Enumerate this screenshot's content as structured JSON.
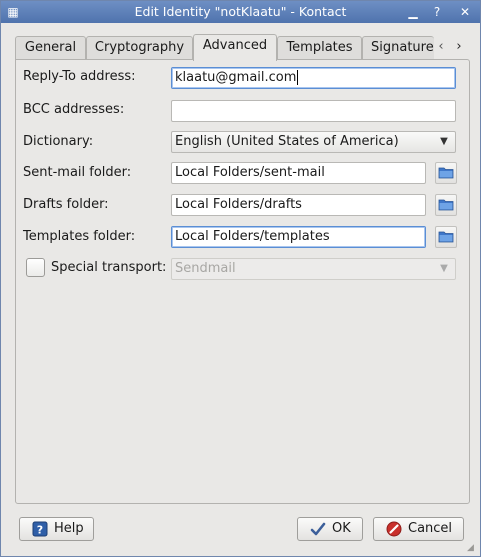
{
  "window": {
    "title": "Edit Identity \"notKlaatu\" - Kontact"
  },
  "tabs": [
    {
      "label": "General"
    },
    {
      "label": "Cryptography"
    },
    {
      "label": "Advanced"
    },
    {
      "label": "Templates"
    },
    {
      "label": "Signature"
    }
  ],
  "form": {
    "reply_to": {
      "label": "Reply-To address:",
      "value": "klaatu@gmail.com"
    },
    "bcc": {
      "label": "BCC addresses:",
      "value": ""
    },
    "dictionary": {
      "label": "Dictionary:",
      "value": "English (United States of America)"
    },
    "sent_mail": {
      "label": "Sent-mail folder:",
      "value": "Local Folders/sent-mail"
    },
    "drafts": {
      "label": "Drafts folder:",
      "value": "Local Folders/drafts"
    },
    "templates": {
      "label": "Templates folder:",
      "value": "Local Folders/templates"
    },
    "transport": {
      "label": "Special transport:",
      "value": "Sendmail",
      "checked": false
    }
  },
  "buttons": {
    "help": "Help",
    "ok": "OK",
    "cancel": "Cancel"
  },
  "colors": {
    "titlebar": "#5a7cb6",
    "focus": "#5b8ed4",
    "folder": "#3f77c9"
  }
}
